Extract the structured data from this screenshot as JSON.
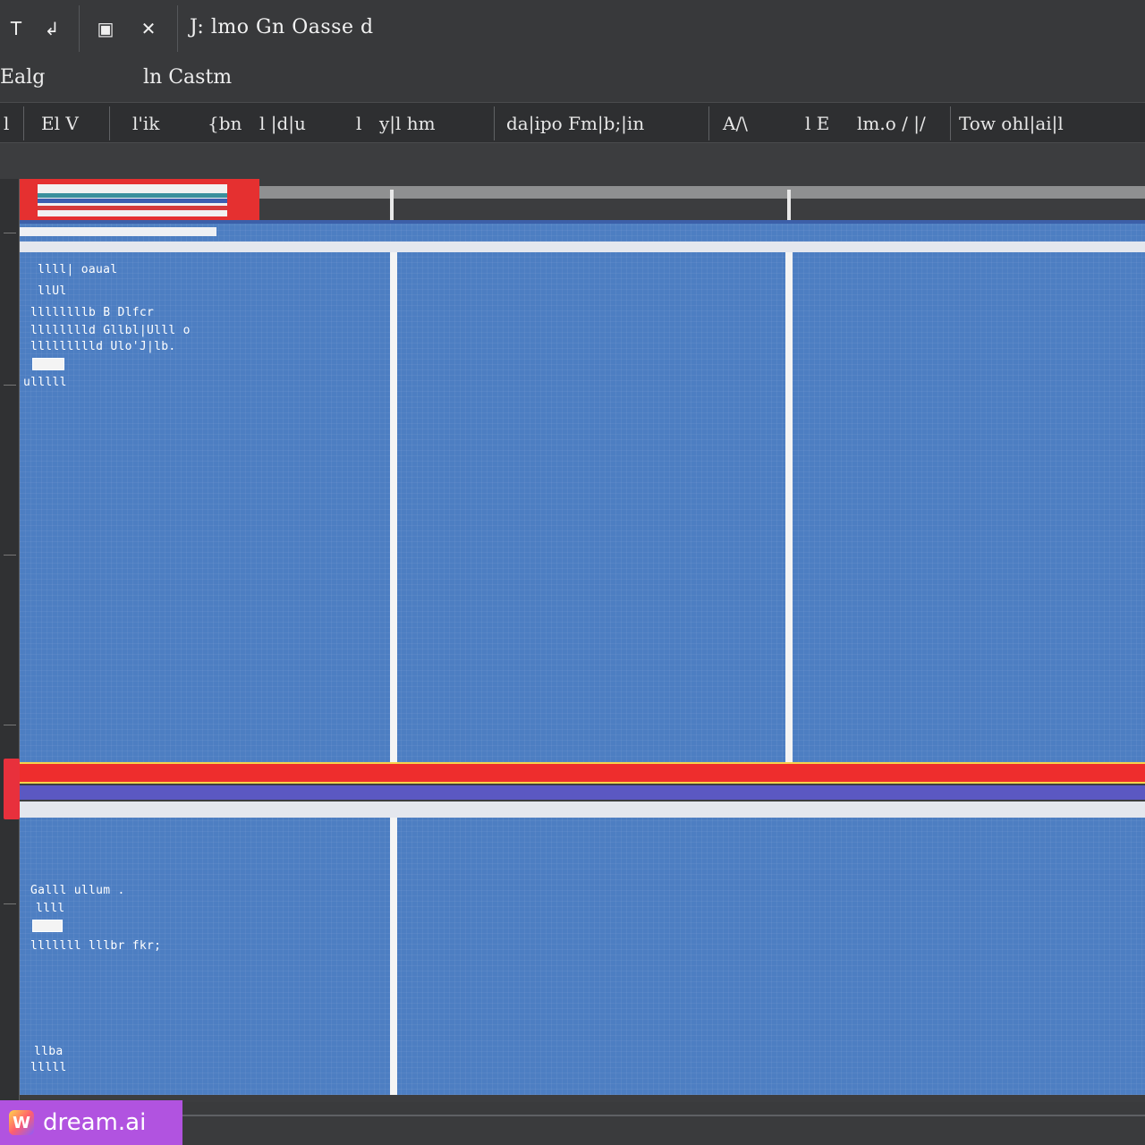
{
  "toolbar": {
    "icons": [
      {
        "name": "text-tool-icon",
        "glyph": "T"
      },
      {
        "name": "undo-icon",
        "glyph": "↲"
      },
      {
        "name": "save-icon",
        "glyph": "▣"
      },
      {
        "name": "close-icon",
        "glyph": "✕"
      }
    ],
    "title": "J: lmo Gn Oasse d"
  },
  "menu": {
    "items": [
      "Ealg",
      "ln Castm"
    ]
  },
  "ribbon": {
    "items": [
      "l",
      "El V",
      "l'ik",
      "{bn",
      "l |d|u",
      "l",
      "y|l hm",
      "da|ipo Fm|b;|in",
      "A/\\",
      "l E",
      "lm.o / |/",
      "Tow ohl|ai|l"
    ]
  },
  "grid": {
    "top_band_text": [
      "llll|  oaual",
      "llUl",
      "llllllllb  B Dlfcr",
      "lllllllld  Gllbl|Ulll  o",
      "llllllllld  Ulo'J|lb.",
      "ulllll"
    ],
    "bottom_band_text": [
      "Galll ullum .",
      "llll",
      "lllllll  lllbr   fkr;",
      "llba",
      "lllll"
    ]
  },
  "colors": {
    "chrome": "#38393b",
    "grid_blue": "#4d7ec2",
    "accent_red": "#ee2d2d",
    "accent_purple": "#5b58c2",
    "highlight_yellow": "#f6d24a"
  },
  "watermark": {
    "icon": "dream-logo-icon",
    "text": "dream.ai"
  }
}
